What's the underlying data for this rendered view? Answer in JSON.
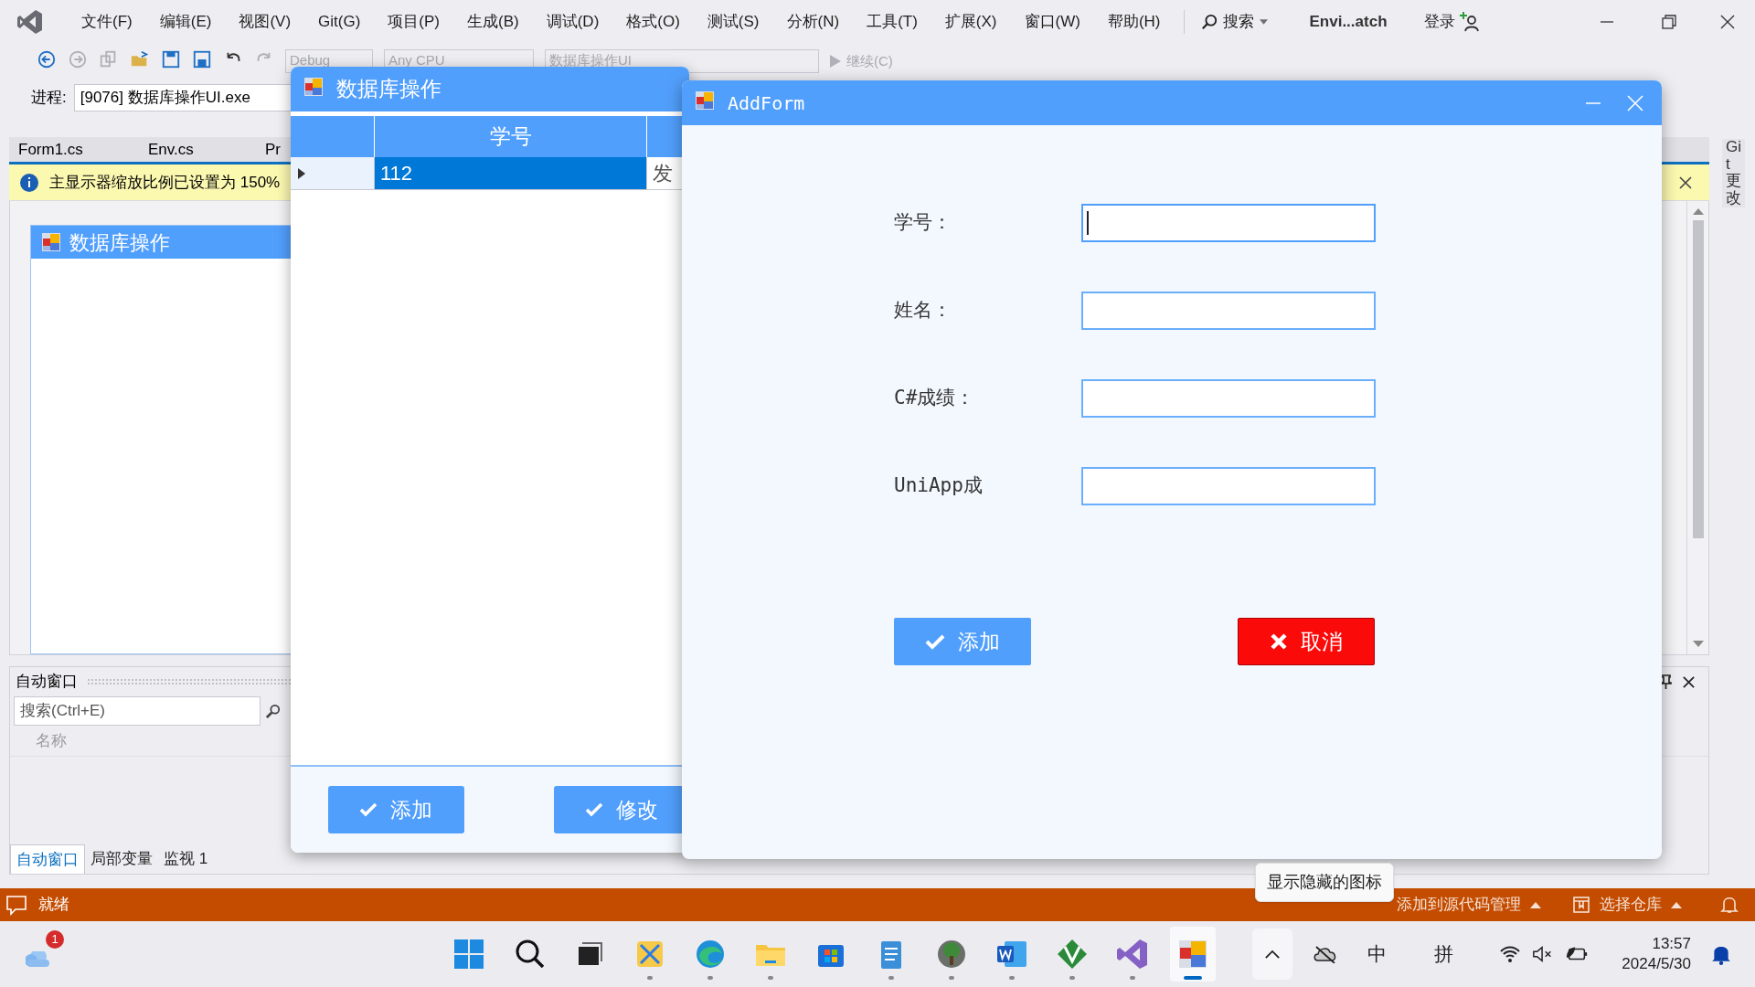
{
  "menu_bar": {
    "items": [
      "文件(F)",
      "编辑(E)",
      "视图(V)",
      "Git(G)",
      "项目(P)",
      "生成(B)",
      "调试(D)",
      "格式(O)",
      "测试(S)",
      "分析(N)",
      "工具(T)",
      "扩展(X)",
      "窗口(W)",
      "帮助(H)"
    ],
    "search": "搜索",
    "solution": "Envi...atch",
    "login": "登录"
  },
  "toolbar": {
    "configuration": "Debug",
    "platform": "Any CPU",
    "startup_project": "数据库操作UI",
    "continue": "继续(C)"
  },
  "process": {
    "label": "进程:",
    "value": "[9076] 数据库操作UI.exe"
  },
  "document_tabs": [
    "Form1.cs",
    "Env.cs",
    "Pr"
  ],
  "info_bar": {
    "message": "主显示器缩放比例已设置为 150%"
  },
  "designer": {
    "form_title": "数据库操作"
  },
  "autos_panel": {
    "title": "自动窗口",
    "search_placeholder": "搜索(Ctrl+E)",
    "column": "名称",
    "tabs": [
      {
        "label": "自动窗口",
        "selected": true
      },
      {
        "label": "局部变量",
        "selected": false
      },
      {
        "label": "监视 1",
        "selected": false
      }
    ]
  },
  "side_tab": "Git 更改",
  "status_bar": {
    "status": "就绪",
    "source_control": "添加到源代码管理",
    "repository": "选择仓库"
  },
  "main_window": {
    "title": "数据库操作",
    "columns": [
      "学号"
    ],
    "rows": [
      {
        "cells": [
          "112",
          "发"
        ],
        "selected": true
      }
    ],
    "buttons": [
      "添加",
      "修改"
    ]
  },
  "add_form": {
    "title": "AddForm",
    "fields": [
      {
        "label": "学号：",
        "focused": true
      },
      {
        "label": "姓名：",
        "focused": false
      },
      {
        "label": "C#成绩：",
        "focused": false
      },
      {
        "label": "UniApp成",
        "focused": false
      }
    ],
    "buttons": [
      {
        "label": "添加",
        "kind": "confirm"
      },
      {
        "label": "取消",
        "kind": "cancel"
      }
    ]
  },
  "tooltip": "显示隐藏的图标",
  "taskbar": {
    "weather_badge": "1",
    "apps": [
      {
        "kind": "start",
        "running": false,
        "active": false
      },
      {
        "kind": "search",
        "running": false,
        "active": false
      },
      {
        "kind": "taskview",
        "running": false,
        "active": false
      },
      {
        "kind": "snipping",
        "running": true,
        "active": false
      },
      {
        "kind": "edge",
        "running": true,
        "active": false
      },
      {
        "kind": "explorer",
        "running": true,
        "active": false
      },
      {
        "kind": "store",
        "running": false,
        "active": false
      },
      {
        "kind": "notepad",
        "running": true,
        "active": false
      },
      {
        "kind": "photos",
        "running": true,
        "active": false
      },
      {
        "kind": "word",
        "running": true,
        "active": false
      },
      {
        "kind": "vim",
        "running": true,
        "active": false
      },
      {
        "kind": "visualstudio",
        "running": true,
        "active": false
      },
      {
        "kind": "formapp",
        "running": true,
        "active": true
      }
    ],
    "ime_mode": "中",
    "ime": "拼",
    "time": "13:57",
    "date": "2024/5/30"
  }
}
